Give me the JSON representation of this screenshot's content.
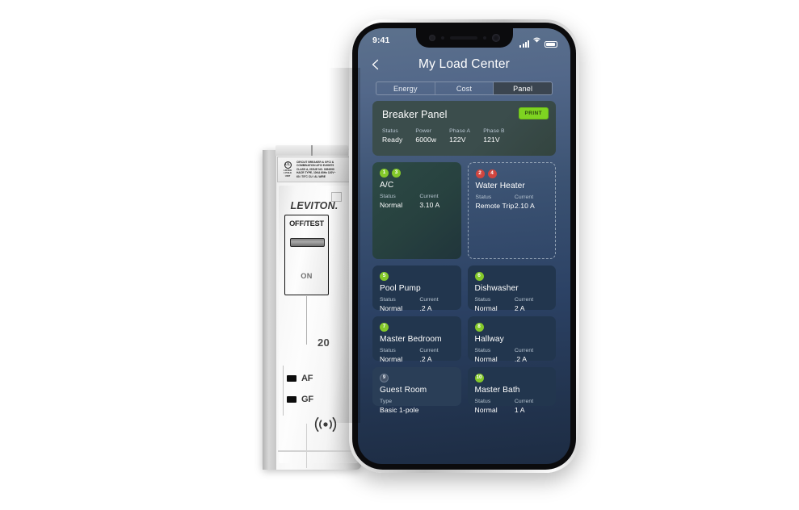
{
  "device": {
    "brand": "LEVITON.",
    "ul_lines": [
      "LISTED",
      "1 POLE",
      "UNIT"
    ],
    "ul_symbol": "UL",
    "label_lines": [
      "CIRCUIT BREAKER & GFCI &",
      "COMBINATION AFCI  E490579",
      "CLASS A, ISSUE NO. 0054599",
      "HACR TYPE, 10KA 60Hz 120V~",
      "60 / 75°C  CU / AL WIRE"
    ],
    "switch_off_label": "OFF/TEST",
    "switch_on_label": "ON",
    "amperage": "20",
    "indicator_af": "AF",
    "indicator_gf": "GF",
    "wireless_icon": "wireless-signal-icon"
  },
  "phone": {
    "status_bar": {
      "time": "9:41",
      "signal_icon": "cellular-signal-icon",
      "wifi_icon": "wifi-icon",
      "battery_icon": "battery-icon"
    },
    "header": {
      "back_icon": "back-chevron-icon",
      "title": "My Load Center"
    },
    "tabs": [
      {
        "label": "Energy",
        "active": false
      },
      {
        "label": "Cost",
        "active": false
      },
      {
        "label": "Panel",
        "active": true
      }
    ],
    "panel_card": {
      "title": "Breaker Panel",
      "print_label": "PRINT",
      "metrics": [
        {
          "key": "Status",
          "value": "Ready"
        },
        {
          "key": "Power",
          "value": "6000w"
        },
        {
          "key": "Phase A",
          "value": "122V"
        },
        {
          "key": "Phase B",
          "value": "121V"
        }
      ]
    },
    "breakers": [
      {
        "name": "A/C",
        "badges": [
          {
            "num": "1",
            "color": "green"
          },
          {
            "num": "3",
            "color": "green"
          }
        ],
        "metrics": [
          {
            "key": "Status",
            "value": "Normal"
          },
          {
            "key": "Current",
            "value": "3.10 A"
          }
        ],
        "style": "ac"
      },
      {
        "name": "Water Heater",
        "badges": [
          {
            "num": "2",
            "color": "red"
          },
          {
            "num": "4",
            "color": "red"
          }
        ],
        "metrics": [
          {
            "key": "Status",
            "value": "Remote Trip"
          },
          {
            "key": "Current",
            "value": "2.10 A"
          }
        ],
        "style": "dashed"
      },
      {
        "name": "Pool Pump",
        "badges": [
          {
            "num": "5",
            "color": "green"
          }
        ],
        "metrics": [
          {
            "key": "Status",
            "value": "Normal"
          },
          {
            "key": "Current",
            "value": ".2 A"
          }
        ],
        "style": "solid"
      },
      {
        "name": "Dishwasher",
        "badges": [
          {
            "num": "6",
            "color": "green"
          }
        ],
        "metrics": [
          {
            "key": "Status",
            "value": "Normal"
          },
          {
            "key": "Current",
            "value": "2 A"
          }
        ],
        "style": "solid"
      },
      {
        "name": "Master Bedroom",
        "badges": [
          {
            "num": "7",
            "color": "green"
          }
        ],
        "metrics": [
          {
            "key": "Status",
            "value": "Normal"
          },
          {
            "key": "Current",
            "value": ".2 A"
          }
        ],
        "style": "solid"
      },
      {
        "name": "Hallway",
        "badges": [
          {
            "num": "8",
            "color": "green"
          }
        ],
        "metrics": [
          {
            "key": "Status",
            "value": "Normal"
          },
          {
            "key": "Current",
            "value": ".2 A"
          }
        ],
        "style": "solid"
      },
      {
        "name": "Guest Room",
        "badges": [
          {
            "num": "9",
            "color": "gray"
          }
        ],
        "metrics": [
          {
            "key": "Type",
            "value": "Basic 1-pole"
          }
        ],
        "style": "light"
      },
      {
        "name": "Master Bath",
        "badges": [
          {
            "num": "10",
            "color": "green"
          }
        ],
        "metrics": [
          {
            "key": "Status",
            "value": "Normal"
          },
          {
            "key": "Current",
            "value": "1 A"
          }
        ],
        "style": "solid"
      }
    ]
  },
  "colors": {
    "accent_green": "#84c92a",
    "print_green": "#7ed321",
    "alert_red": "#d0453f",
    "screen_bg_top": "#5c718c",
    "screen_bg_bottom": "#1d2c43"
  }
}
